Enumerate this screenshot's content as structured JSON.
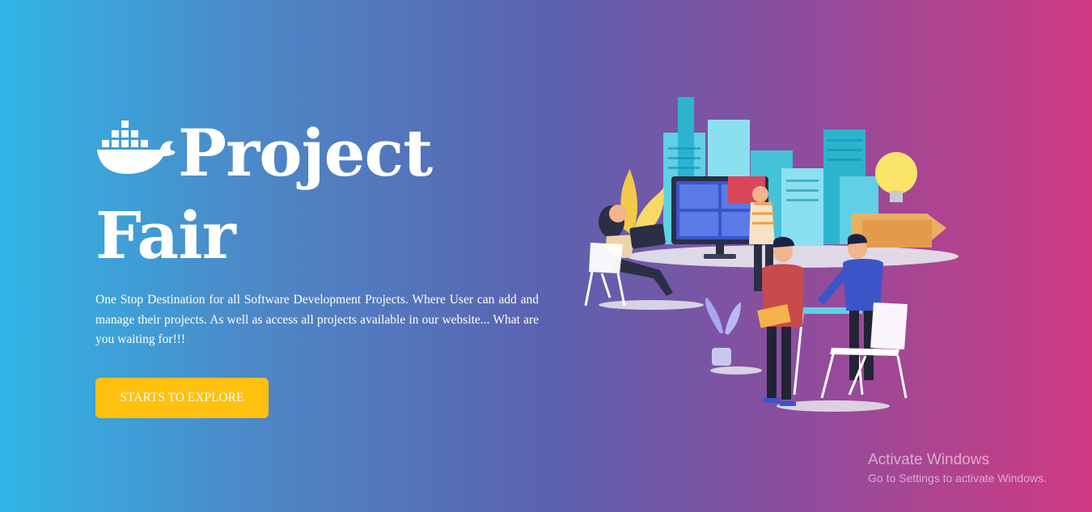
{
  "hero": {
    "title_line_1": "Project",
    "title_line_2": "Fair",
    "tagline": "One Stop Destination for all Software Development Projects. Where User can add and manage their projects. As well as access all projects available in our website... What are you waiting for!!!",
    "cta_label": "STARTS TO EXPLORE"
  },
  "logo": {
    "icon": "docker-whale-icon"
  },
  "illustration": {
    "icon": "team-collaboration-illustration"
  },
  "windows_watermark": {
    "title": "Activate Windows",
    "subtitle": "Go to Settings to activate Windows."
  },
  "colors": {
    "gradient_start": "#2fb6e6",
    "gradient_end": "#d23a82",
    "cta_background": "#ffc00f",
    "text": "#ffffff"
  }
}
